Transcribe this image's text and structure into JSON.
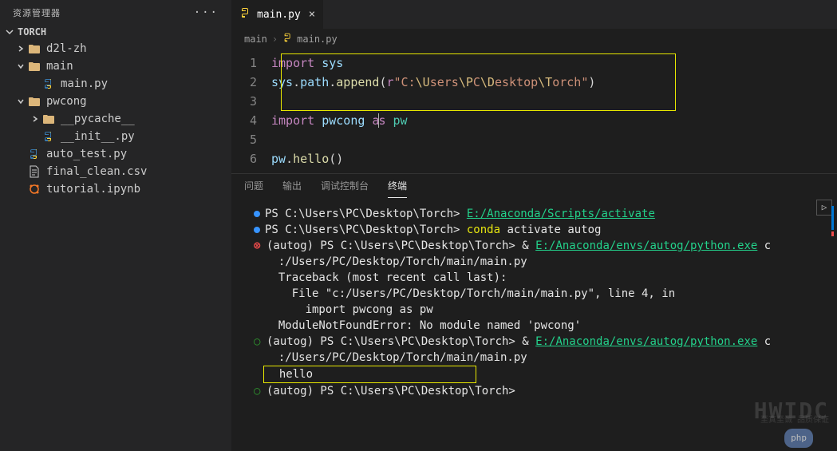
{
  "sidebar": {
    "title": "资源管理器",
    "root": "TORCH",
    "items": [
      {
        "label": "d2l-zh",
        "type": "folder",
        "collapsed": true,
        "indent": 1
      },
      {
        "label": "main",
        "type": "folder",
        "collapsed": false,
        "indent": 1
      },
      {
        "label": "main.py",
        "type": "python",
        "indent": 2
      },
      {
        "label": "pwcong",
        "type": "folder",
        "collapsed": false,
        "indent": 1
      },
      {
        "label": "__pycache__",
        "type": "folder",
        "collapsed": true,
        "indent": 2
      },
      {
        "label": "__init__.py",
        "type": "python",
        "indent": 2
      },
      {
        "label": "auto_test.py",
        "type": "python",
        "indent": 1
      },
      {
        "label": "final_clean.csv",
        "type": "file",
        "indent": 1
      },
      {
        "label": "tutorial.ipynb",
        "type": "notebook",
        "indent": 1
      }
    ]
  },
  "tab": {
    "label": "main.py"
  },
  "breadcrumb": {
    "folder": "main",
    "file": "main.py"
  },
  "editor": {
    "lines": [
      {
        "n": "1",
        "html": "<span class='kw'>import</span> <span class='var'>sys</span>"
      },
      {
        "n": "2",
        "html": "<span class='var'>sys</span><span class='white'>.</span><span class='var'>path</span><span class='white'>.</span><span class='fn'>append</span><span class='white'>(</span><span class='kw'>r</span><span class='str'>\"C:</span><span class='esc'>\\U</span><span class='str'>sers</span><span class='esc'>\\P</span><span class='str'>C</span><span class='esc'>\\D</span><span class='str'>esktop</span><span class='esc'>\\T</span><span class='str'>orch\"</span><span class='white'>)</span>"
      },
      {
        "n": "3",
        "html": ""
      },
      {
        "n": "4",
        "html": "<span class='kw'>import</span> <span class='var'>pwcong</span> <span class='kw'>a</span><span class='caret'></span><span class='kw'>s</span> <span class='pw-mod'>pw</span>"
      },
      {
        "n": "5",
        "html": ""
      },
      {
        "n": "6",
        "html": "<span class='var'>pw</span><span class='white'>.</span><span class='fn'>hello</span><span class='white'>()</span>"
      }
    ]
  },
  "panel": {
    "tabs": [
      "问题",
      "输出",
      "调试控制台",
      "终端"
    ],
    "active": 3
  },
  "terminal": {
    "lines": [
      {
        "bullet": "blue",
        "pre": "PS C:\\Users\\PC\\Desktop\\Torch> ",
        "cmd": "E:/Anaconda/Scripts/activate",
        "cmdClass": "term-green-u"
      },
      {
        "bullet": "blue",
        "pre": "PS C:\\Users\\PC\\Desktop\\Torch> ",
        "cmd": "conda",
        "cmdClass": "term-cmd",
        "post": " activate autog"
      },
      {
        "bullet": "redx",
        "pre": "(autog) PS C:\\Users\\PC\\Desktop\\Torch> & ",
        "cmd": "E:/Anaconda/envs/autog/python.exe",
        "cmdClass": "term-green-u",
        "post": " c"
      },
      {
        "pre": "  :/Users/PC/Desktop/Torch/main/main.py"
      },
      {
        "pre": "  Traceback (most recent call last):"
      },
      {
        "pre": "    File \"c:/Users/PC/Desktop/Torch/main/main.py\", line 4, in <module>"
      },
      {
        "pre": "      import pwcong as pw"
      },
      {
        "pre": "  ModuleNotFoundError: No module named 'pwcong'"
      },
      {
        "bullet": "green",
        "pre": "(autog) PS C:\\Users\\PC\\Desktop\\Torch> & ",
        "cmd": "E:/Anaconda/envs/autog/python.exe",
        "cmdClass": "term-green-u",
        "post": " c"
      },
      {
        "pre": "  :/Users/PC/Desktop/Torch/main/main.py"
      },
      {
        "pre": "  hello",
        "box": true
      },
      {
        "bullet": "green",
        "pre": "(autog) PS C:\\Users\\PC\\Desktop\\Torch>"
      }
    ]
  },
  "watermark": {
    "main": "HWIDC",
    "sub": "至真至诚 品质保证",
    "badge": "php"
  }
}
